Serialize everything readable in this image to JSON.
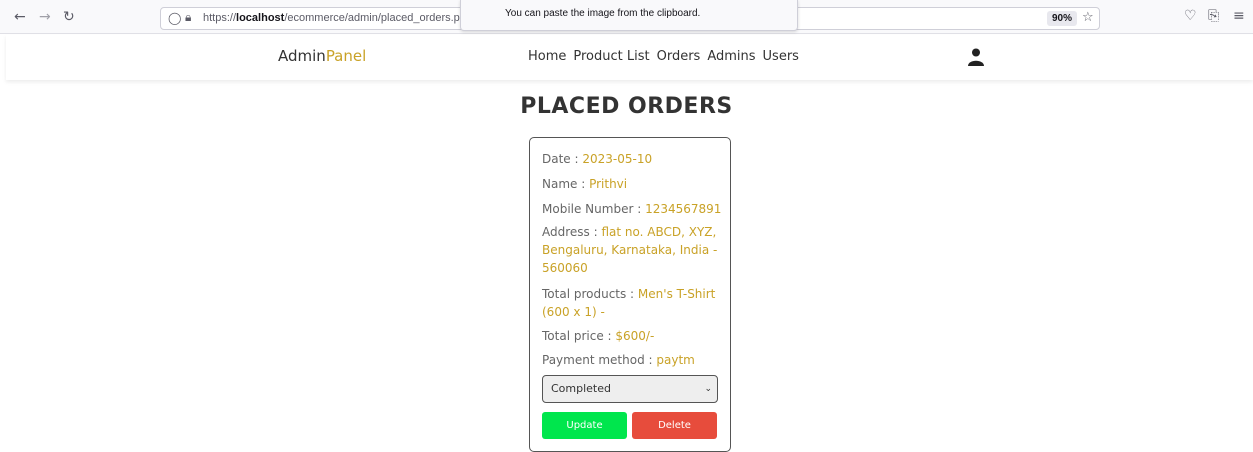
{
  "browser": {
    "url_prefix": "https://",
    "url_host": "localhost",
    "url_path": "/ecommerce/admin/placed_orders.ph",
    "zoom": "90%",
    "toast": "You can paste the image from the clipboard."
  },
  "header": {
    "logo_main": "Admin",
    "logo_accent": "Panel",
    "nav": [
      "Home",
      "Product List",
      "Orders",
      "Admins",
      "Users"
    ]
  },
  "page": {
    "title": "PLACED ORDERS"
  },
  "order": {
    "date_label": "Date : ",
    "date": "2023-05-10",
    "name_label": "Name : ",
    "name": "Prithvi",
    "mobile_label": "Mobile Number : ",
    "mobile": "1234567891",
    "address_label": "Address : ",
    "address": "flat no. ABCD, XYZ, Bengaluru, Karnataka, India - 560060",
    "products_label": "Total products : ",
    "products": "Men's T-Shirt (600 x 1) -",
    "price_label": "Total price : ",
    "price": "$600/-",
    "payment_label": "Payment method : ",
    "payment": "paytm",
    "status": "Completed",
    "update_label": "Update",
    "delete_label": "Delete"
  },
  "colors": {
    "accent": "#c9a227",
    "update": "#00e64d",
    "delete": "#e74c3c"
  }
}
